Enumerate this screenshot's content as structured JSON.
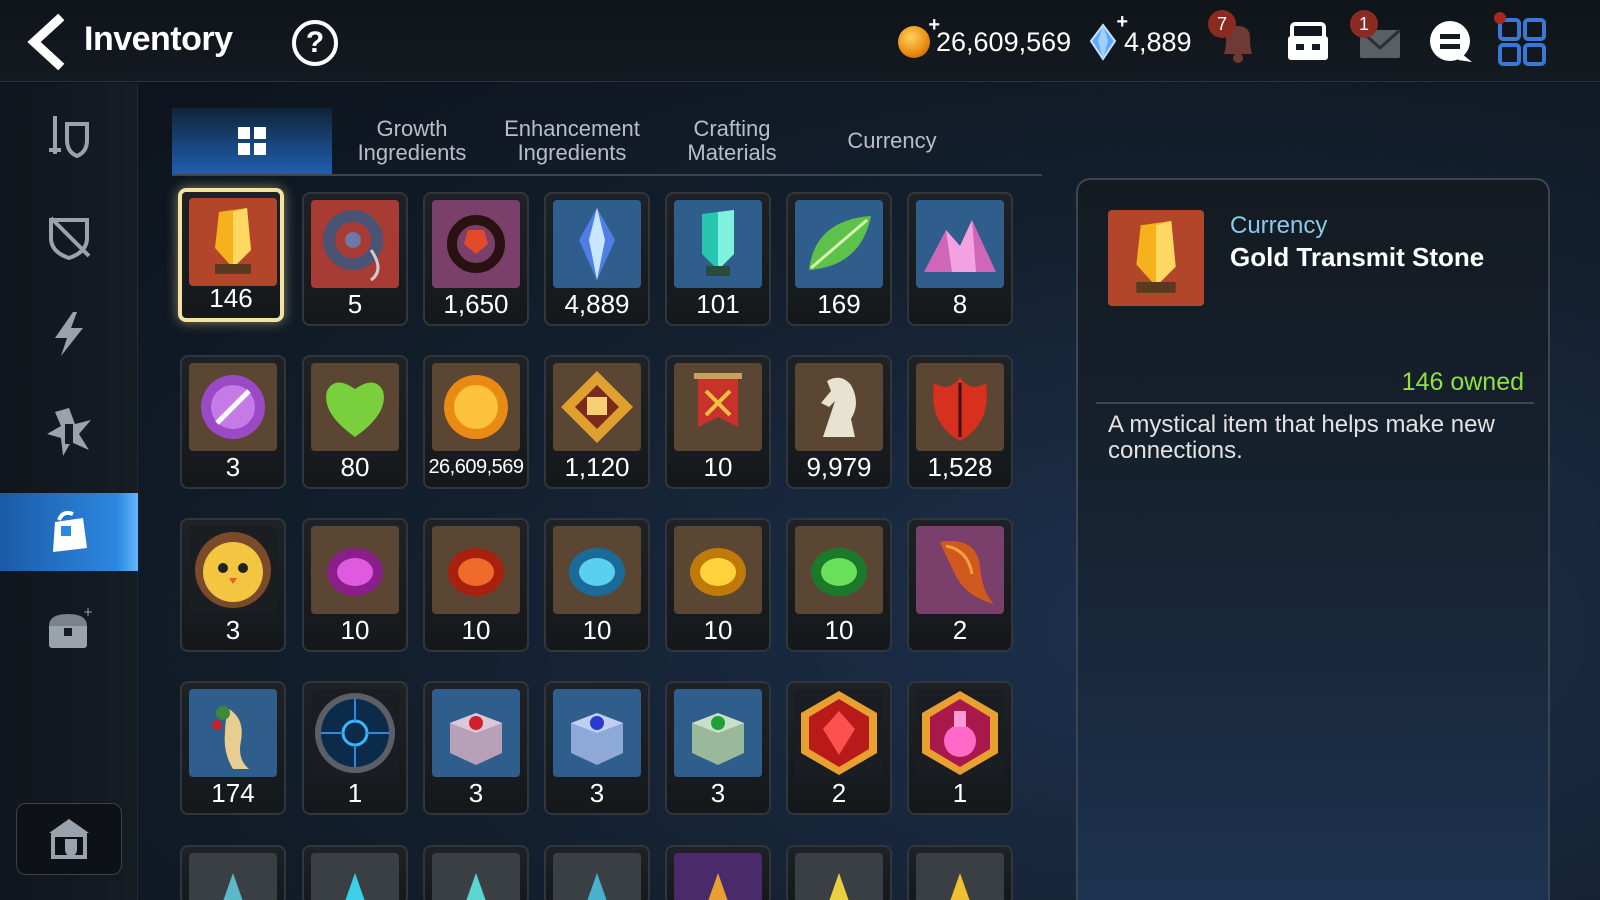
{
  "header": {
    "title": "Inventory",
    "help_label": "?",
    "gold": "26,609,569",
    "skystone": "4,889",
    "notifications_badge": "7",
    "mail_badge": "1"
  },
  "tabs": [
    {
      "label": "",
      "icon": "grid-icon",
      "active": true
    },
    {
      "label": "Growth\nIngredients"
    },
    {
      "label": "Enhancement\nIngredients"
    },
    {
      "label": "Crafting\nMaterials"
    },
    {
      "label": "Currency"
    }
  ],
  "sidebar": [
    "equipment-icon",
    "broken-shield-icon",
    "lightning-icon",
    "artifact-icon",
    "bag-icon",
    "chest-icon"
  ],
  "items": {
    "row1": [
      {
        "count": "146",
        "icon": "gold-transmit-stone"
      },
      {
        "count": "5",
        "icon": "pendant"
      },
      {
        "count": "1,650",
        "icon": "red-ring"
      },
      {
        "count": "4,889",
        "icon": "skystone"
      },
      {
        "count": "101",
        "icon": "teal-crystal"
      },
      {
        "count": "169",
        "icon": "green-leaf"
      },
      {
        "count": "8",
        "icon": "pink-crystal-pile"
      }
    ],
    "row2": [
      {
        "count": "3",
        "icon": "purple-seal"
      },
      {
        "count": "80",
        "icon": "green-heart"
      },
      {
        "count": "26,609,569",
        "icon": "gold-coin"
      },
      {
        "count": "1,120",
        "icon": "fist-emblem"
      },
      {
        "count": "10",
        "icon": "red-banner"
      },
      {
        "count": "9,979",
        "icon": "knight-piece"
      },
      {
        "count": "1,528",
        "icon": "red-leaf"
      }
    ],
    "row3": [
      {
        "count": "3",
        "icon": "yellow-bird"
      },
      {
        "count": "10",
        "icon": "purple-rune"
      },
      {
        "count": "10",
        "icon": "red-rune"
      },
      {
        "count": "10",
        "icon": "blue-rune"
      },
      {
        "count": "10",
        "icon": "gold-rune"
      },
      {
        "count": "10",
        "icon": "green-rune"
      },
      {
        "count": "2",
        "icon": "phoenix-feather"
      }
    ],
    "row4": [
      {
        "count": "174",
        "icon": "ginseng"
      },
      {
        "count": "1",
        "icon": "blue-orb"
      },
      {
        "count": "3",
        "icon": "red-box"
      },
      {
        "count": "3",
        "icon": "blue-box"
      },
      {
        "count": "3",
        "icon": "green-box"
      },
      {
        "count": "2",
        "icon": "red-gem-hex"
      },
      {
        "count": "1",
        "icon": "pink-potion-hex"
      }
    ]
  },
  "detail": {
    "category": "Currency",
    "name": "Gold Transmit Stone",
    "owned": "146 owned",
    "description": "A mystical item that helps make new connections."
  },
  "colors": {
    "accent": "#2d88e0",
    "owned": "#8fe040",
    "category": "#8ac9e8",
    "selected_border": "#f2e3a2"
  }
}
